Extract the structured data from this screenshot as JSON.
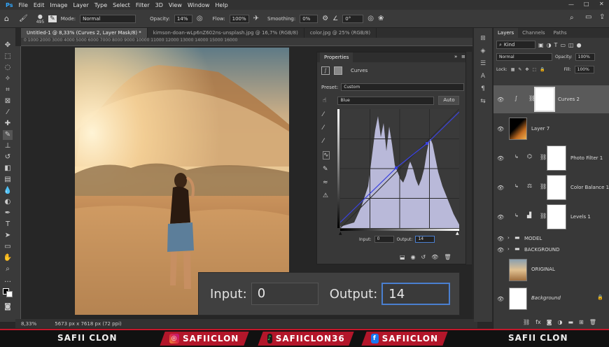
{
  "menu": [
    "File",
    "Edit",
    "Image",
    "Layer",
    "Type",
    "Select",
    "Filter",
    "3D",
    "View",
    "Window",
    "Help"
  ],
  "options": {
    "brush_size": "495",
    "mode_label": "Mode:",
    "mode_value": "Normal",
    "opacity_label": "Opacity:",
    "opacity_value": "14%",
    "flow_label": "Flow:",
    "flow_value": "100%",
    "smoothing_label": "Smoothing:",
    "smoothing_value": "0%",
    "angle_value": "0°"
  },
  "tabs": [
    "Untitled-1 @ 8,33% (Curves 2, Layer Mask/8) *",
    "kimson-doan-wLp6nZ602ns-unsplash.jpg @ 16,7% (RGB/8)",
    "color.jpg @ 25% (RGB/8)"
  ],
  "ruler_ticks": "0    1000   2000   3000   4000   5000   6000   7000   8000   9000   10000   11000   12000   13000   14000   15000   16000",
  "status": {
    "zoom": "8,33%",
    "doc_size": "5673 px x 7618 px (72 ppi)"
  },
  "properties": {
    "title": "Properties",
    "adjustment": "Curves",
    "preset_label": "Preset:",
    "preset_value": "Custom",
    "channel_value": "Blue",
    "auto_label": "Auto",
    "input_label": "Input:",
    "input_value": "0",
    "output_label": "Output:",
    "output_value": "14"
  },
  "zoom_overlay": {
    "input_label": "Input:",
    "input_value": "0",
    "output_label": "Output:",
    "output_value": "14"
  },
  "layers_panel": {
    "tabs": [
      "Layers",
      "Channels",
      "Paths"
    ],
    "kind_label": "Kind",
    "blend_mode": "Normal",
    "opacity_label": "Opacity:",
    "opacity_value": "100%",
    "lock_label": "Lock:",
    "fill_label": "Fill:",
    "fill_value": "100%",
    "layers": [
      {
        "name": "Curves 2"
      },
      {
        "name": "Layer 7"
      },
      {
        "name": "Photo Filter 1"
      },
      {
        "name": "Color Balance 1"
      },
      {
        "name": "Levels 1"
      },
      {
        "name": "MODEL"
      },
      {
        "name": "BACKGROUND"
      },
      {
        "name": "ORIGINAL"
      },
      {
        "name": "Background"
      }
    ]
  },
  "footer": {
    "left_name": "SAFII CLON",
    "right_name": "SAFII CLON",
    "instagram": "SAFIICLON",
    "tiktok": "SAFIICLON36",
    "facebook": "SAFIICLON"
  },
  "colors": {
    "accent_red": "#c4182b",
    "curve_blue": "#3a42e0",
    "focus_blue": "#4a7fd0"
  }
}
